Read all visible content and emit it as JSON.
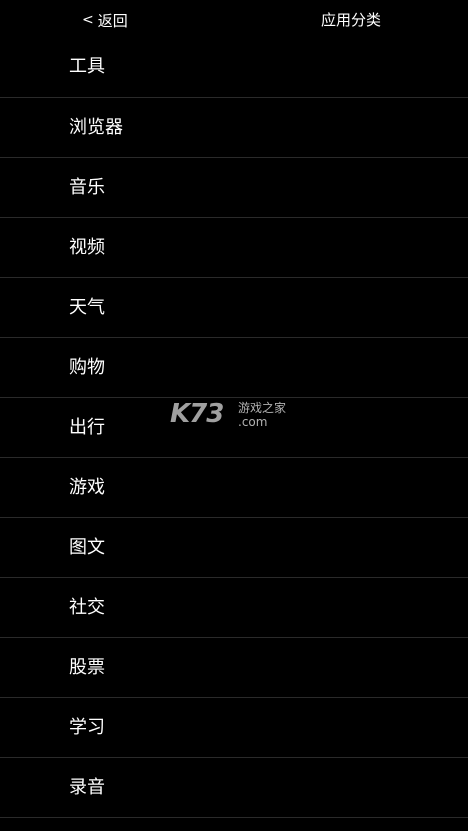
{
  "header": {
    "back_chevron": "<",
    "back_label": "返回",
    "title": "应用分类"
  },
  "categories": [
    {
      "label": "工具"
    },
    {
      "label": "浏览器"
    },
    {
      "label": "音乐"
    },
    {
      "label": "视频"
    },
    {
      "label": "天气"
    },
    {
      "label": "购物"
    },
    {
      "label": "出行"
    },
    {
      "label": "游戏"
    },
    {
      "label": "图文"
    },
    {
      "label": "社交"
    },
    {
      "label": "股票"
    },
    {
      "label": "学习"
    },
    {
      "label": "录音"
    }
  ],
  "watermark": {
    "logo": "K73",
    "subtitle": "游戏之家",
    "domain": ".com"
  },
  "colors": {
    "background": "#000000",
    "text": "#ffffff",
    "divider": "#2a2a2a"
  }
}
